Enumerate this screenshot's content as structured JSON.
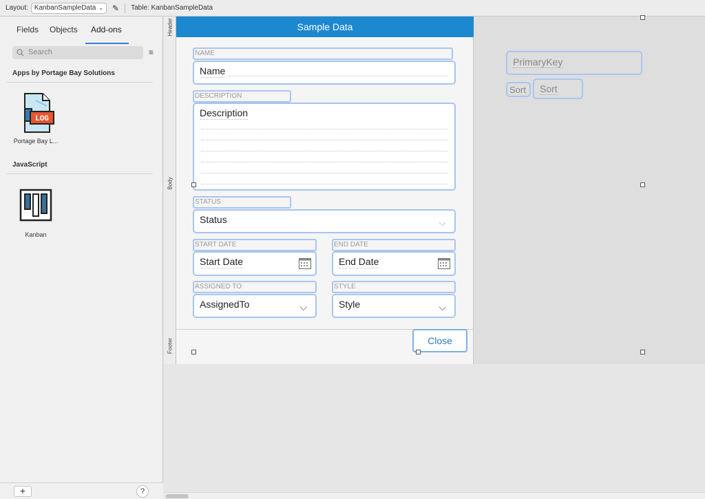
{
  "toolbar": {
    "layout_label": "Layout:",
    "layout_value": "KanbanSampleData",
    "table_label": "Table: KanbanSampleData"
  },
  "left_panel": {
    "tabs": [
      "Fields",
      "Objects",
      "Add-ons"
    ],
    "active_tab": "Add-ons",
    "search_placeholder": "Search",
    "sections": [
      {
        "title": "Apps by Portage Bay Solutions",
        "items": [
          {
            "label": "Portage Bay L...",
            "icon": "log-icon"
          }
        ]
      },
      {
        "title": "JavaScript",
        "items": [
          {
            "label": "Kanban",
            "icon": "kanban-icon"
          }
        ]
      }
    ],
    "add_button": "+",
    "help_button": "?"
  },
  "canvas": {
    "parts": [
      "Header",
      "Body",
      "Footer"
    ],
    "header_title": "Sample Data",
    "fields": {
      "name": {
        "label": "NAME",
        "value": "Name"
      },
      "description": {
        "label": "DESCRIPTION",
        "value": "Description"
      },
      "status": {
        "label": "STATUS",
        "value": "Status"
      },
      "start_date": {
        "label": "START DATE",
        "value": "Start Date"
      },
      "end_date": {
        "label": "END DATE",
        "value": "End Date"
      },
      "assigned_to": {
        "label": "ASSIGNED TO",
        "value": "AssignedTo"
      },
      "style": {
        "label": "STYLE",
        "value": "Style"
      }
    },
    "close_button": "Close",
    "hidden_fields": {
      "primary_key": "PrimaryKey",
      "sort_label": "Sort",
      "sort_field": "Sort"
    }
  },
  "colors": {
    "header_bg": "#1b88d0",
    "field_border": "#a6c4ee",
    "accent": "#3a7bd5"
  }
}
